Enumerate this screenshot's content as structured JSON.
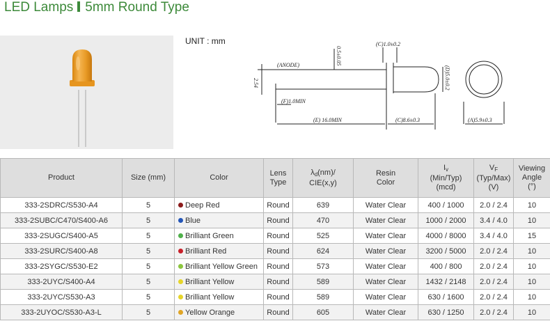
{
  "title": {
    "main": "LED Lamps",
    "sub": "5mm Round Type"
  },
  "unit_label": "UNIT : mm",
  "drawing_labels": {
    "anode": "(ANODE)",
    "lead_pitch": "2.54",
    "lead_width": "0.5±0.05",
    "flange": "(C)1.0±0.2",
    "flat": "(F)1.0MIN",
    "lead_length": "(E) 16.0MIN",
    "body_length": "(C)8.6±0.3",
    "body_dia": "(D)5.0±0.2",
    "flange_dia": "(A)5.9±0.3"
  },
  "table": {
    "headers": {
      "product": "Product",
      "size": "Size (mm)",
      "color": "Color",
      "lens_1": "Lens",
      "lens_2": "Type",
      "wl_sym": "λ",
      "wl_sub": "d",
      "wl_1": "(nm)/",
      "wl_2": "CIE(x,y)",
      "resin_1": "Resin",
      "resin_2": "Color",
      "iv_sym": "I",
      "iv_sub": "v",
      "iv_1": "(Min/Typ)",
      "iv_2": "(mcd)",
      "vf_sym": "V",
      "vf_sub": "F",
      "vf_1": "(Typ/Max)",
      "vf_2": "(V)",
      "va_1": "Viewing",
      "va_2": "Angle",
      "va_3": "(°)"
    },
    "rows": [
      {
        "product": "333-2SDRC/S530-A4",
        "size": "5",
        "color": "Deep Red",
        "dot": "#8b1a1a",
        "lens": "Round",
        "wl": "639",
        "resin": "Water Clear",
        "iv": "400 / 1000",
        "vf": "2.0 / 2.4",
        "angle": "10"
      },
      {
        "product": "333-2SUBC/C470/S400-A6",
        "size": "5",
        "color": "Blue",
        "dot": "#2456b8",
        "lens": "Round",
        "wl": "470",
        "resin": "Water Clear",
        "iv": "1000 / 2000",
        "vf": "3.4 / 4.0",
        "angle": "10"
      },
      {
        "product": "333-2SUGC/S400-A5",
        "size": "5",
        "color": "Brilliant Green",
        "dot": "#4fb04a",
        "lens": "Round",
        "wl": "525",
        "resin": "Water Clear",
        "iv": "4000 / 8000",
        "vf": "3.4 / 4.0",
        "angle": "15"
      },
      {
        "product": "333-2SURC/S400-A8",
        "size": "5",
        "color": "Brilliant Red",
        "dot": "#c8202a",
        "lens": "Round",
        "wl": "624",
        "resin": "Water Clear",
        "iv": "3200 / 5000",
        "vf": "2.0 / 2.4",
        "angle": "10"
      },
      {
        "product": "333-2SYGC/S530-E2",
        "size": "5",
        "color": "Brilliant Yellow Green",
        "dot": "#8cc63f",
        "lens": "Round",
        "wl": "573",
        "resin": "Water Clear",
        "iv": "400 / 800",
        "vf": "2.0 / 2.4",
        "angle": "10"
      },
      {
        "product": "333-2UYC/S400-A4",
        "size": "5",
        "color": "Brilliant Yellow",
        "dot": "#e6d52a",
        "lens": "Round",
        "wl": "589",
        "resin": "Water Clear",
        "iv": "1432 / 2148",
        "vf": "2.0 / 2.4",
        "angle": "10"
      },
      {
        "product": "333-2UYC/S530-A3",
        "size": "5",
        "color": "Brilliant Yellow",
        "dot": "#e6d52a",
        "lens": "Round",
        "wl": "589",
        "resin": "Water Clear",
        "iv": "630 / 1600",
        "vf": "2.0 / 2.4",
        "angle": "10"
      },
      {
        "product": "333-2UYOC/S530-A3-L",
        "size": "5",
        "color": "Yellow Orange",
        "dot": "#e0a526",
        "lens": "Round",
        "wl": "605",
        "resin": "Water Clear",
        "iv": "630 / 1250",
        "vf": "2.0 / 2.4",
        "angle": "10"
      }
    ]
  }
}
